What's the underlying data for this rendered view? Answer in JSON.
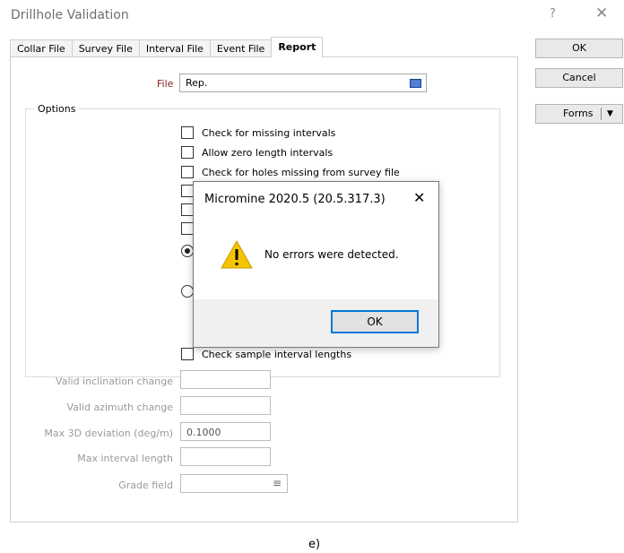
{
  "window": {
    "title": "Drillhole Validation",
    "help": "?",
    "close": "✕"
  },
  "tabs": [
    "Collar File",
    "Survey File",
    "Interval File",
    "Event File",
    "Report"
  ],
  "buttons": {
    "ok": "OK",
    "cancel": "Cancel",
    "forms": "Forms"
  },
  "file": {
    "label": "File",
    "value": "Rep."
  },
  "options": {
    "label": "Options",
    "checks": [
      "Check for missing intervals",
      "Allow zero length intervals",
      "Check for holes missing from survey file"
    ],
    "sample_check": "Check sample interval lengths"
  },
  "fields": [
    {
      "label": "Valid inclination change",
      "value": ""
    },
    {
      "label": "Valid azimuth change",
      "value": ""
    },
    {
      "label": "Max 3D deviation (deg/m)",
      "value": "0.1000"
    },
    {
      "label": "Max interval length",
      "value": ""
    },
    {
      "label": "Grade field",
      "value": ""
    }
  ],
  "dialog": {
    "title": "Micromine 2020.5 (20.5.317.3)",
    "close": "✕",
    "message": "No errors were detected.",
    "ok": "OK"
  },
  "caption": "e)"
}
